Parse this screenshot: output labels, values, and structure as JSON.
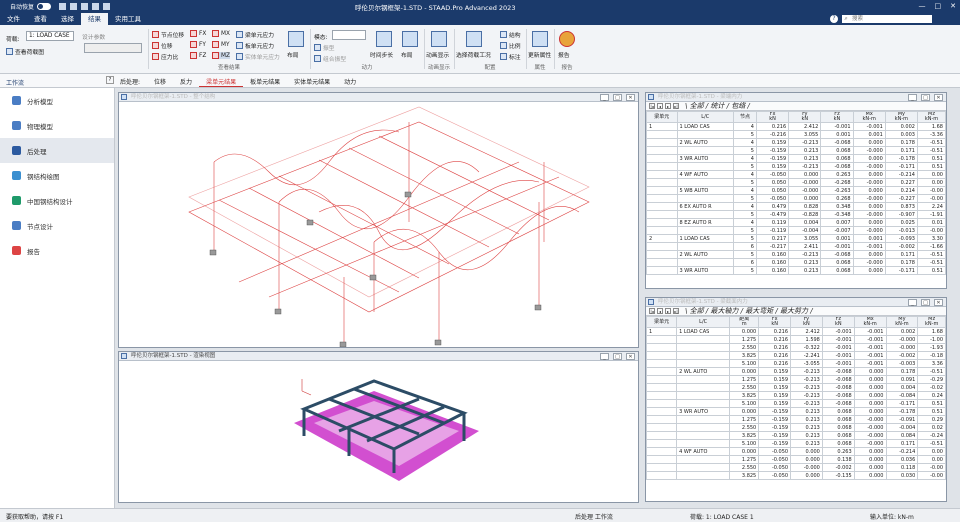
{
  "window": {
    "autosave_label": "自动恢复",
    "title": "呼伦贝尔钢框架-1.STD - STAAD.Pro Advanced 2023"
  },
  "menu": {
    "tabs": [
      "文件",
      "查看",
      "选择",
      "结果",
      "实用工具"
    ],
    "active": "结果",
    "search_placeholder": "搜索"
  },
  "ribbon": {
    "loadcase_label": "荷载:",
    "loadcase_value": "1: LOAD CASE",
    "view_load_diagram": "查看荷载图",
    "design_params": "设计参数",
    "node_disp": "节点位移",
    "disp": "位移",
    "stress_ratio": "应力比",
    "fx": "FX",
    "fy": "FY",
    "fz": "FZ",
    "mx": "MX",
    "my": "MY",
    "mz": "MZ",
    "beam_stress": "梁单元应力",
    "plate_stress": "板单元应力",
    "solid_stress": "实体单元应力",
    "layout": "布局",
    "group_beam_results": "查看结果",
    "mode_label": "模态:",
    "dynamic_view": "振型",
    "animate": "动画",
    "combined_view": "组合振型",
    "time_steps": "时间步长",
    "group_dynamic": "动力",
    "anim_display": "动画显示",
    "group_anim": "动画显示",
    "select_load": "选择荷载工况",
    "structure": "结构",
    "ratio": "比例",
    "labels": "标注",
    "group_config": "配置",
    "update_props": "更新属性",
    "group_update": "属性",
    "report": "报告",
    "group_report": "报告"
  },
  "workflow": {
    "title": "工作流",
    "items": [
      "分析模型",
      "物理模型",
      "后处理",
      "钢结构绘图",
      "中国钢结构设计",
      "节点设计",
      "报告"
    ],
    "active": "后处理"
  },
  "post_tabs": {
    "label": "后处理:",
    "tabs": [
      "位移",
      "反力",
      "梁单元结果",
      "板单元结果",
      "实体单元结果",
      "动力"
    ],
    "active": "梁单元结果"
  },
  "viewports": {
    "model_title": "呼伦贝尔钢框架-1.STD - 整个结构",
    "render_title": "呼伦贝尔钢框架-1.STD - 渲染视图",
    "table1_title": "呼伦贝尔钢框架-1.STD - 梁端内力",
    "table2_title": "呼伦贝尔钢框架-1.STD - 梁截面内力",
    "table1_tabs": "\\ 全部 / 统计 / 包络 /",
    "table2_tabs": "\\ 全部 / 最大轴力 / 最大弯矩 / 最大剪力 /"
  },
  "table1": {
    "headers": [
      "梁单元",
      "L/C",
      "节点",
      "Fx\nkN",
      "Fy\nkN",
      "Fz\nkN",
      "Mx\nkN-m",
      "My\nkN-m",
      "Mz\nkN-m"
    ],
    "rows": [
      [
        "1",
        "1 LOAD CAS",
        "4",
        "0.216",
        "2.412",
        "-0.001",
        "-0.001",
        "0.002",
        "1.68"
      ],
      [
        "",
        "",
        "5",
        "-0.216",
        "3.055",
        "0.001",
        "0.001",
        "0.003",
        "-3.36"
      ],
      [
        "",
        "2 WL AUTO",
        "4",
        "0.159",
        "-0.213",
        "-0.068",
        "0.000",
        "0.178",
        "-0.51"
      ],
      [
        "",
        "",
        "5",
        "-0.159",
        "0.213",
        "0.068",
        "-0.000",
        "0.171",
        "-0.51"
      ],
      [
        "",
        "3 WR AUTO",
        "4",
        "-0.159",
        "0.213",
        "0.068",
        "0.000",
        "-0.178",
        "0.51"
      ],
      [
        "",
        "",
        "5",
        "0.159",
        "-0.213",
        "-0.068",
        "-0.000",
        "-0.171",
        "0.51"
      ],
      [
        "",
        "4 WF AUTO",
        "4",
        "-0.050",
        "0.000",
        "0.263",
        "0.000",
        "-0.214",
        "0.00"
      ],
      [
        "",
        "",
        "5",
        "0.050",
        "-0.000",
        "-0.268",
        "-0.000",
        "0.227",
        "0.00"
      ],
      [
        "",
        "5 WB AUTO",
        "4",
        "0.050",
        "-0.000",
        "-0.263",
        "0.000",
        "0.214",
        "-0.00"
      ],
      [
        "",
        "",
        "5",
        "-0.050",
        "0.000",
        "0.268",
        "-0.000",
        "-0.227",
        "-0.00"
      ],
      [
        "",
        "6 EX AUTO R",
        "4",
        "0.479",
        "0.828",
        "0.348",
        "0.000",
        "0.873",
        "2.24"
      ],
      [
        "",
        "",
        "5",
        "-0.479",
        "-0.828",
        "-0.348",
        "-0.000",
        "-0.907",
        "-1.91"
      ],
      [
        "",
        "8 EZ AUTO R",
        "4",
        "0.119",
        "0.004",
        "0.007",
        "0.000",
        "0.025",
        "0.01"
      ],
      [
        "",
        "",
        "5",
        "-0.119",
        "-0.004",
        "-0.007",
        "-0.000",
        "-0.013",
        "-0.00"
      ],
      [
        "2",
        "1 LOAD CAS",
        "5",
        "0.217",
        "3.055",
        "0.001",
        "0.001",
        "-0.093",
        "3.30"
      ],
      [
        "",
        "",
        "6",
        "-0.217",
        "2.411",
        "-0.001",
        "-0.001",
        "-0.002",
        "-1.66"
      ],
      [
        "",
        "2 WL AUTO",
        "5",
        "0.160",
        "-0.213",
        "-0.068",
        "0.000",
        "0.171",
        "-0.51"
      ],
      [
        "",
        "",
        "6",
        "0.160",
        "0.213",
        "0.068",
        "-0.000",
        "0.178",
        "-0.51"
      ],
      [
        "",
        "3 WR AUTO",
        "5",
        "0.160",
        "0.213",
        "0.068",
        "0.000",
        "-0.171",
        "0.51"
      ]
    ]
  },
  "table2": {
    "headers": [
      "梁单元",
      "L/C",
      "距离\nm",
      "Fx\nkN",
      "Fy\nkN",
      "Fz\nkN",
      "Mx\nkN-m",
      "My\nkN-m",
      "Mz\nkN-m"
    ],
    "rows": [
      [
        "1",
        "1 LOAD CAS",
        "0.000",
        "0.216",
        "2.412",
        "-0.001",
        "-0.001",
        "0.002",
        "1.68"
      ],
      [
        "",
        "",
        "1.275",
        "0.216",
        "1.598",
        "-0.001",
        "-0.001",
        "-0.000",
        "-1.00"
      ],
      [
        "",
        "",
        "2.550",
        "0.216",
        "-0.322",
        "-0.001",
        "-0.001",
        "-0.000",
        "-1.93"
      ],
      [
        "",
        "",
        "3.825",
        "0.216",
        "-2.241",
        "-0.001",
        "-0.001",
        "-0.002",
        "-0.18"
      ],
      [
        "",
        "",
        "5.100",
        "0.216",
        "-3.055",
        "-0.001",
        "-0.001",
        "-0.003",
        "3.36"
      ],
      [
        "",
        "2 WL AUTO",
        "0.000",
        "0.159",
        "-0.213",
        "-0.068",
        "0.000",
        "0.178",
        "-0.51"
      ],
      [
        "",
        "",
        "1.275",
        "0.159",
        "-0.213",
        "-0.068",
        "0.000",
        "0.091",
        "-0.29"
      ],
      [
        "",
        "",
        "2.550",
        "0.159",
        "-0.213",
        "-0.068",
        "0.000",
        "0.004",
        "-0.02"
      ],
      [
        "",
        "",
        "3.825",
        "0.159",
        "-0.213",
        "-0.068",
        "0.000",
        "-0.084",
        "0.24"
      ],
      [
        "",
        "",
        "5.100",
        "0.159",
        "-0.213",
        "-0.068",
        "0.000",
        "-0.171",
        "0.51"
      ],
      [
        "",
        "3 WR AUTO",
        "0.000",
        "-0.159",
        "0.213",
        "0.068",
        "0.000",
        "-0.178",
        "0.51"
      ],
      [
        "",
        "",
        "1.275",
        "-0.159",
        "0.213",
        "0.068",
        "-0.000",
        "-0.091",
        "0.29"
      ],
      [
        "",
        "",
        "2.550",
        "-0.159",
        "0.213",
        "0.068",
        "-0.000",
        "-0.004",
        "0.02"
      ],
      [
        "",
        "",
        "3.825",
        "-0.159",
        "0.213",
        "0.068",
        "-0.000",
        "0.084",
        "-0.24"
      ],
      [
        "",
        "",
        "5.100",
        "-0.159",
        "0.213",
        "0.068",
        "-0.000",
        "0.171",
        "-0.51"
      ],
      [
        "",
        "4 WF AUTO",
        "0.000",
        "-0.050",
        "0.000",
        "0.263",
        "0.000",
        "-0.214",
        "0.00"
      ],
      [
        "",
        "",
        "1.275",
        "-0.050",
        "0.000",
        "0.138",
        "0.000",
        "0.036",
        "0.00"
      ],
      [
        "",
        "",
        "2.550",
        "-0.050",
        "-0.000",
        "-0.002",
        "0.000",
        "0.118",
        "-0.00"
      ],
      [
        "",
        "",
        "3.825",
        "-0.050",
        "0.000",
        "-0.135",
        "0.000",
        "0.030",
        "-0.00"
      ]
    ]
  },
  "status": {
    "help_text": "要获取帮助，请按 F1",
    "mode": "后处理 工作流",
    "load": "荷载: 1: LOAD CASE 1",
    "units": "输入单位: kN-m"
  }
}
